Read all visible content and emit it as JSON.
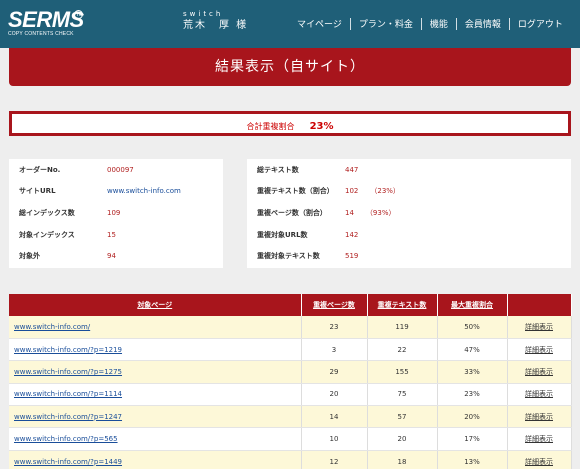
{
  "header": {
    "logo": "SERMS",
    "logo_sub": "COPY CONTENTS CHECK",
    "user_id": "switch",
    "user_name": "荒木　厚 様",
    "nav": [
      "マイページ",
      "プラン・料金",
      "機能",
      "会員情報",
      "ログアウト"
    ]
  },
  "banner": {
    "title": "結果表示（自サイト）"
  },
  "total": {
    "label": "合計重複割合",
    "value": "23%"
  },
  "info_left": [
    {
      "label": "オーダーNo.",
      "value": "000097"
    },
    {
      "label": "サイトURL",
      "value": "www.switch-info.com"
    },
    {
      "label": "総インデックス数",
      "value": "109"
    },
    {
      "label": "対象インデックス",
      "value": "15"
    },
    {
      "label": "対象外",
      "value": "94"
    }
  ],
  "info_right": [
    {
      "label": "総テキスト数",
      "value": "447",
      "pct": ""
    },
    {
      "label": "重複テキスト数（割合）",
      "value": "102",
      "pct": "（23%）"
    },
    {
      "label": "重複ページ数（割合）",
      "value": "14",
      "pct": "（93%）"
    },
    {
      "label": "重複対象URL数",
      "value": "142",
      "pct": ""
    },
    {
      "label": "重複対象テキスト数",
      "value": "519",
      "pct": ""
    }
  ],
  "table": {
    "headers": [
      "対象ページ",
      "重複ページ数",
      "重複テキスト数",
      "最大重複割合",
      ""
    ],
    "rows": [
      {
        "url": "www.switch-info.com/",
        "pages": "23",
        "texts": "119",
        "ratio": "50%",
        "detail": "詳細表示"
      },
      {
        "url": "www.switch-info.com/?p=1219",
        "pages": "3",
        "texts": "22",
        "ratio": "47%",
        "detail": "詳細表示"
      },
      {
        "url": "www.switch-info.com/?p=1275",
        "pages": "29",
        "texts": "155",
        "ratio": "33%",
        "detail": "詳細表示"
      },
      {
        "url": "www.switch-info.com/?p=1114",
        "pages": "20",
        "texts": "75",
        "ratio": "23%",
        "detail": "詳細表示"
      },
      {
        "url": "www.switch-info.com/?p=1247",
        "pages": "14",
        "texts": "57",
        "ratio": "20%",
        "detail": "詳細表示"
      },
      {
        "url": "www.switch-info.com/?p=565",
        "pages": "10",
        "texts": "20",
        "ratio": "17%",
        "detail": "詳細表示"
      },
      {
        "url": "www.switch-info.com/?p=1449",
        "pages": "12",
        "texts": "18",
        "ratio": "13%",
        "detail": "詳細表示"
      }
    ]
  }
}
